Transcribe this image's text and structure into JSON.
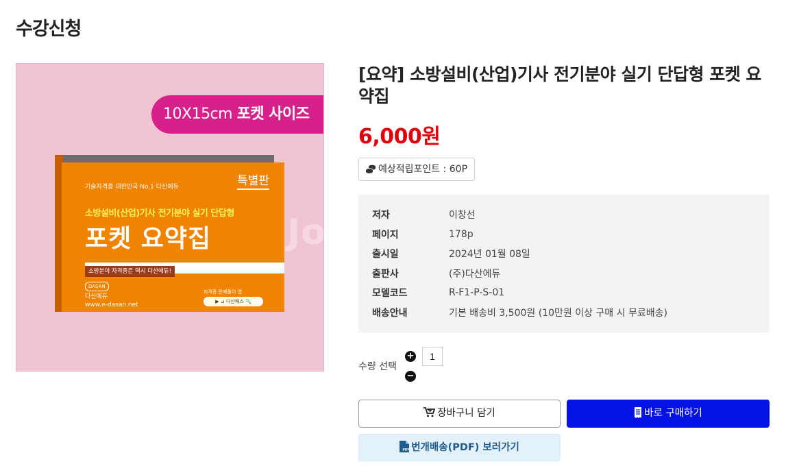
{
  "page": {
    "title": "수강신청"
  },
  "image": {
    "size_badge_num": "10X15cm",
    "size_badge_text": "포켓 사이즈",
    "book_tag": "기술자격증 대한민국 No.1 다산에듀",
    "book_edition": "특별판",
    "book_subtitle": "소방설비(산업)기사 전기분야 실기 단답형",
    "book_title": "포켓 요약집",
    "book_slogan": "소방분야 자격증은 역시 다산에듀!",
    "book_publisher_logo": "DASAN",
    "book_publisher_name": "다산에듀",
    "book_publisher_url": "www.e-dasan.net",
    "book_app_label": "자격증 문제풀이 앱",
    "book_app_bar": "▶ ⊿ 다산패스 🔍",
    "watermark": "Jooomaal"
  },
  "product": {
    "name": "[요약] 소방설비(산업)기사 전기분야 실기 단답형 포켓 요약집",
    "price": "6,000원",
    "points": "예상적립포인트 : 60P",
    "info": [
      {
        "label": "저자",
        "value": "이창선"
      },
      {
        "label": "페이지",
        "value": "178p"
      },
      {
        "label": "출시일",
        "value": "2024년 01월 08일"
      },
      {
        "label": "출판사",
        "value": "(주)다산에듀"
      },
      {
        "label": "모델코드",
        "value": "R-F1-P-S-01"
      },
      {
        "label": "배송안내",
        "value": "기본 배송비 3,500원 (10만원 이상 구매 시 무료배송)"
      }
    ]
  },
  "quantity": {
    "label": "수량 선택",
    "value": "1",
    "plus": "+",
    "minus": "−"
  },
  "buttons": {
    "cart": "장바구니 담기",
    "buy": "바로 구매하기",
    "pdf": "번개배송(PDF) 보러가기"
  },
  "colors": {
    "price": "#e0000b",
    "buy": "#0412e4",
    "badge": "#d6218b",
    "cover": "#f08300",
    "image_bg": "#f0c4d3"
  }
}
